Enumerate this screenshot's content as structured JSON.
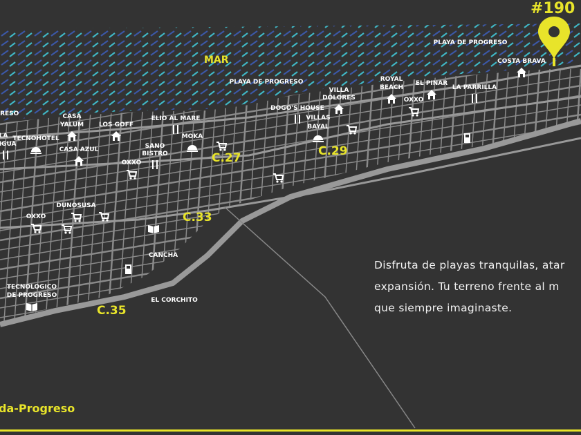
{
  "lot_number": "#190",
  "sea_label": "MAR",
  "street_labels": [
    "C.27",
    "C.29",
    "C.33",
    "C.35"
  ],
  "places": [
    {
      "text": "PLAYA DE PROGRESO",
      "icon": "none"
    },
    {
      "text": "COSTA BRAVA",
      "icon": "house-icon"
    },
    {
      "text": "PLAYA DE PROGRESO",
      "icon": "none"
    },
    {
      "text": "ROYAL",
      "icon": "none"
    },
    {
      "text": "BEACH",
      "icon": "house-icon"
    },
    {
      "text": "EL PINAR",
      "icon": "house-icon"
    },
    {
      "text": "LA PARRILLA",
      "icon": "restaurant-icon"
    },
    {
      "text": "OXXO",
      "icon": "cart-icon"
    },
    {
      "text": "VILLA",
      "icon": "none"
    },
    {
      "text": "DOLORES",
      "icon": "house-icon"
    },
    {
      "text": "DOGO'S HOUSE",
      "icon": "restaurant-icon"
    },
    {
      "text": "VILLAS",
      "icon": "none"
    },
    {
      "text": "BAYAL",
      "icon": "hotel-icon"
    },
    {
      "text": "ELIO AL MARE",
      "icon": "restaurant-icon"
    },
    {
      "text": "MOKA",
      "icon": "hotel-icon"
    },
    {
      "text": "LOS GOFF",
      "icon": "house-icon"
    },
    {
      "text": "CASA",
      "icon": "none"
    },
    {
      "text": "YALUM",
      "icon": "house-icon"
    },
    {
      "text": "GRESO",
      "icon": "none"
    },
    {
      "text": "LA",
      "icon": "none"
    },
    {
      "text": "TIGUA",
      "icon": "restaurant-icon"
    },
    {
      "text": "TECNOHOTEL",
      "icon": "hotel-icon"
    },
    {
      "text": "CASA AZUL",
      "icon": "house-icon"
    },
    {
      "text": "SANO",
      "icon": "none"
    },
    {
      "text": "BISTRO",
      "icon": "restaurant-icon"
    },
    {
      "text": "OXXO",
      "icon": "cart-icon"
    },
    {
      "text": "DUNOSUSA",
      "icon": "cart-icon"
    },
    {
      "text": "OXXO",
      "icon": "cart-icon"
    },
    {
      "text": "CANCHA",
      "icon": "none"
    },
    {
      "text": "TECNOLOGICO",
      "icon": "none"
    },
    {
      "text": "DE PROGRESO",
      "icon": "book-icon"
    },
    {
      "text": "EL CORCHITO",
      "icon": "none"
    }
  ],
  "description": [
    "Disfruta de playas tranquilas, atar",
    "expansión. Tu terreno frente al m",
    "que siempre imaginaste."
  ],
  "footer_text": "da-Progreso",
  "colors": {
    "background": "#333333",
    "roads": "#8a8a8a",
    "highway": "#999999",
    "accent_yellow": "#e8e42a",
    "sea_stripe_blue": "#3b57a6",
    "sea_stripe_teal": "#3fb7c5",
    "labels": "#ffffff"
  }
}
